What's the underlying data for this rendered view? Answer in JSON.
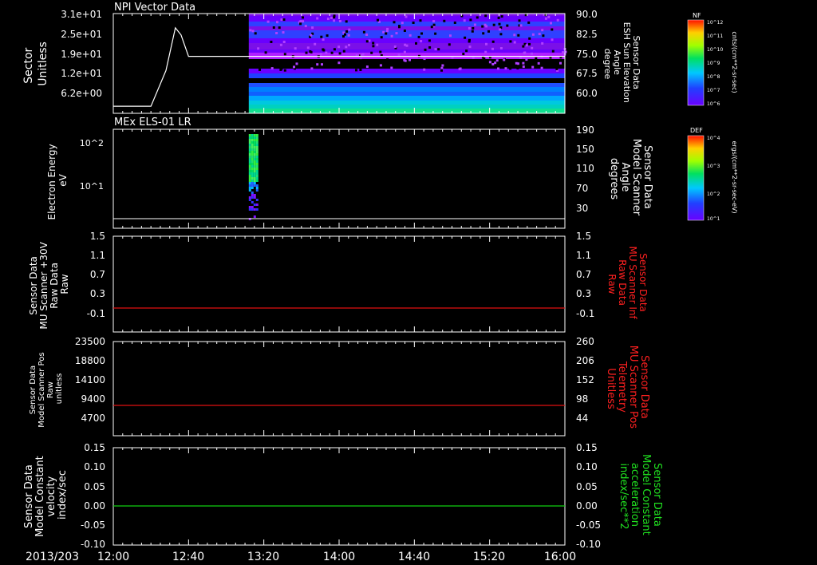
{
  "time_axis": {
    "date_label": "2013/203",
    "tick_labels": [
      "12:00",
      "12:40",
      "13:20",
      "14:00",
      "14:40",
      "15:20",
      "16:00"
    ]
  },
  "colorbars": [
    {
      "title": "NF",
      "unit": "cnts/(cm**2-sr-sec)",
      "tick_labels": [
        "10^12",
        "10^11",
        "10^10",
        "10^9",
        "10^8",
        "10^7",
        "10^6"
      ]
    },
    {
      "title": "DEF",
      "unit": "ergs/(cm**2-sr-sec-eV)",
      "tick_labels": [
        "10^4",
        "10^3",
        "10^2",
        "10^1"
      ]
    }
  ],
  "chart_data": [
    {
      "type": "heatmap",
      "title": "NPI Vector Data",
      "ylabel": "Sector\nUnitless",
      "y_tick_labels": [
        "3.1e+01",
        "2.5e+01",
        "1.9e+01",
        "1.2e+01",
        "6.2e+00"
      ],
      "ylim": [
        0,
        31
      ],
      "y2label": "Sensor Data\nESH Sun Elevation\nAngle\ndegree",
      "y2_tick_labels": [
        "90.0",
        "82.5",
        "75.0",
        "67.5",
        "60.0"
      ],
      "y2lim": [
        55,
        90
      ],
      "heatmap_start": "13:12",
      "heatmap_end": "16:00",
      "line_series": {
        "x": [
          "12:00",
          "12:20",
          "12:28",
          "12:33",
          "12:36",
          "12:40",
          "16:00"
        ],
        "y": [
          57.5,
          57.5,
          70,
          85,
          82.5,
          75,
          75
        ]
      }
    },
    {
      "type": "heatmap",
      "title": "MEx ELS-01 LR",
      "ylabel": "Electron Energy\neV",
      "y_tick_labels": [
        "10^2",
        "10^1"
      ],
      "y2label": "Sensor Data\nModel Scanner\nAngle\ndegrees",
      "y2_tick_labels": [
        "190",
        "150",
        "110",
        "70",
        "30"
      ],
      "y2lim": [
        0,
        190
      ],
      "heatmap_start": "13:12",
      "heatmap_end": "13:16",
      "line_series": {
        "x": [
          "12:00",
          "16:00"
        ],
        "y": [
          10,
          10
        ]
      }
    },
    {
      "type": "line",
      "ylabel": "Sensor Data\nMU Scanner +30V\nRaw Data\nRaw",
      "y_tick_labels": [
        "1.5",
        "1.1",
        "0.7",
        "0.3",
        "-0.1"
      ],
      "ylim": [
        -0.3,
        1.5
      ],
      "y2label": "Sensor Data\nMU Scanner Inf\nRaw Data\nRaw",
      "y2_tick_labels": [
        "1.5",
        "1.1",
        "0.7",
        "0.3",
        "-0.1"
      ],
      "series": [
        {
          "x": [
            "12:00",
            "16:00"
          ],
          "y": [
            0,
            0
          ],
          "color": "#e01010"
        }
      ]
    },
    {
      "type": "line",
      "ylabel": "Sensor Data\nModel Scanner Pos\nRaw\nunitless",
      "y_tick_labels": [
        "23500",
        "18800",
        "14100",
        "9400",
        "4700"
      ],
      "ylim": [
        0,
        23500
      ],
      "y2label": "Sensor Data\nMU Scanner Pos\nTelemetry\nUnitless",
      "y2_tick_labels": [
        "260",
        "206",
        "152",
        "98",
        "44"
      ],
      "series": [
        {
          "x": [
            "12:00",
            "16:00"
          ],
          "y": [
            8000,
            8000
          ],
          "color": "#e01010"
        }
      ]
    },
    {
      "type": "line",
      "ylabel": "Sensor Data\nModel Constant\nvelocity\nindex/sec",
      "y_tick_labels": [
        "0.15",
        "0.10",
        "0.05",
        "0.00",
        "-0.05",
        "-0.10"
      ],
      "ylim": [
        -0.1,
        0.15
      ],
      "y2label": "Sensor Data\nModel Constant\nacceleration\nindex/sec**2",
      "y2_tick_labels": [
        "0.15",
        "0.10",
        "0.05",
        "0.00",
        "-0.05",
        "-0.10"
      ],
      "series": [
        {
          "x": [
            "12:00",
            "16:00"
          ],
          "y": [
            0,
            0
          ],
          "color": "#10d010"
        }
      ]
    }
  ],
  "colors": {
    "axis": "#ffffff",
    "red_label": "#ff2020",
    "green_label": "#20e020"
  }
}
